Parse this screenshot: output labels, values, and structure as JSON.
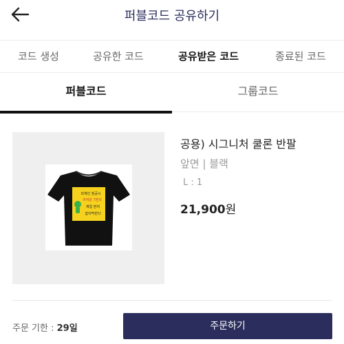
{
  "header": {
    "title": "퍼블코드 공유하기"
  },
  "top_tabs": [
    {
      "label": "코드 생성",
      "active": false
    },
    {
      "label": "공유한 코드",
      "active": false
    },
    {
      "label": "공유받은 코드",
      "active": true
    },
    {
      "label": "종료된 코드",
      "active": false
    }
  ],
  "sub_tabs": [
    {
      "label": "퍼블코드",
      "active": true
    },
    {
      "label": "그룹코드",
      "active": false
    }
  ],
  "product": {
    "name": "공용) 시그니처 쿨론 반팔",
    "option": "앞면 | 블랙",
    "size": "L : 1",
    "price_number": "21,900",
    "price_unit": "원",
    "print_text": [
      "외계인 침공시",
      "귀여운 7번의",
      "제일 먼저",
      "잡아먹힌다"
    ]
  },
  "footer": {
    "deadline_label": "주문 기한 : ",
    "deadline_value": "29일",
    "order_button": "주문하기"
  },
  "colors": {
    "brand_navy": "#2b2d5c",
    "shirt": "#111111",
    "print_panel": "#f6d21f",
    "alien": "#39b04a"
  }
}
